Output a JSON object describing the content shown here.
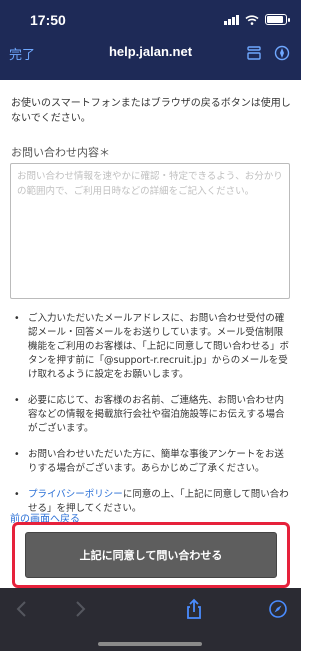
{
  "status": {
    "time": "17:50"
  },
  "nav": {
    "done_label": "完了",
    "url": "help.jalan.net"
  },
  "page": {
    "intro_text": "お使いのスマートフォンまたはブラウザの戻るボタンは使用しないでください。",
    "field_label": "お問い合わせ内容＊",
    "textarea_placeholder": "お問い合わせ情報を速やかに確認・特定できるよう、お分かりの範囲内で、ご利用日時などの詳細をご記入ください。",
    "notes": [
      "ご入力いただいたメールアドレスに、お問い合わせ受付の確認メール・回答メールをお送りしています。メール受信制限機能をご利用のお客様は、「上記に同意して問い合わせる」ボタンを押す前に「@support-r.recruit.jp」からのメールを受け取れるように設定をお願いします。",
      "必要に応じて、お客様のお名前、ご連絡先、お問い合わせ内容などの情報を掲載旅行会社や宿泊施設等にお伝えする場合がございます。",
      "お問い合わせいただいた方に、簡単な事後アンケートをお送りする場合がございます。あらかじめご了承ください。"
    ],
    "privacy_link": "プライバシーポリシー",
    "privacy_text": "に同意の上、「上記に同意して問い合わせる」を押してください。",
    "back_link": "前の画面へ戻る",
    "submit_label": "上記に同意して問い合わせる"
  },
  "colors": {
    "header_bg": "#1e2a57",
    "link": "#2a6fd6",
    "highlight_frame": "#e6213b",
    "button_bg": "#5e5e5e",
    "toolbar_bg": "#2b2b33"
  },
  "icons": {
    "reader": "reader-icon",
    "compass": "compass-icon",
    "back": "back-arrow-icon",
    "forward": "forward-arrow-icon",
    "share": "share-icon"
  }
}
